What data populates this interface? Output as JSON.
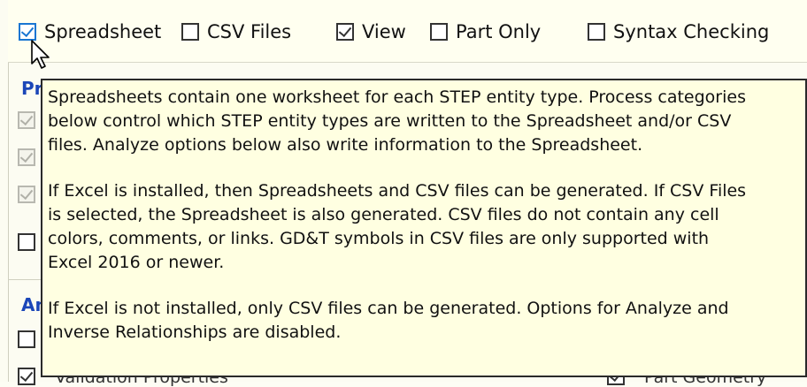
{
  "options": {
    "spreadsheet": {
      "label": "Spreadsheet",
      "checked": true
    },
    "csv_files": {
      "label": "CSV Files",
      "checked": false
    },
    "view": {
      "label": "View",
      "checked": true
    },
    "part_only": {
      "label": "Part Only",
      "checked": false
    },
    "syntax_checking": {
      "label": "Syntax Checking",
      "checked": false
    }
  },
  "process_section": {
    "title_fragment": "Pr"
  },
  "analyze_section": {
    "title_fragment": "An"
  },
  "background": {
    "validation_properties_fragment": "Validation Properties",
    "part_geometry_fragment": "Part Geometry"
  },
  "tooltip": {
    "lines": [
      "Spreadsheets contain one worksheet for each STEP entity type.  Process categories",
      "below control which STEP entity types are written to the Spreadsheet and/or CSV",
      "files.  Analyze options below also write information to the Spreadsheet.",
      "",
      "If Excel is installed, then Spreadsheets and CSV files can be generated.  If CSV Files",
      "is selected, the Spreadsheet is also generated.  CSV files do not contain any cell",
      "colors, comments, or links.  GD&T symbols in CSV files are only supported with",
      "Excel 2016 or newer.",
      "",
      "If Excel is not installed, only CSV files can be generated.  Options for Analyze and",
      "Inverse Relationships are disabled."
    ]
  }
}
